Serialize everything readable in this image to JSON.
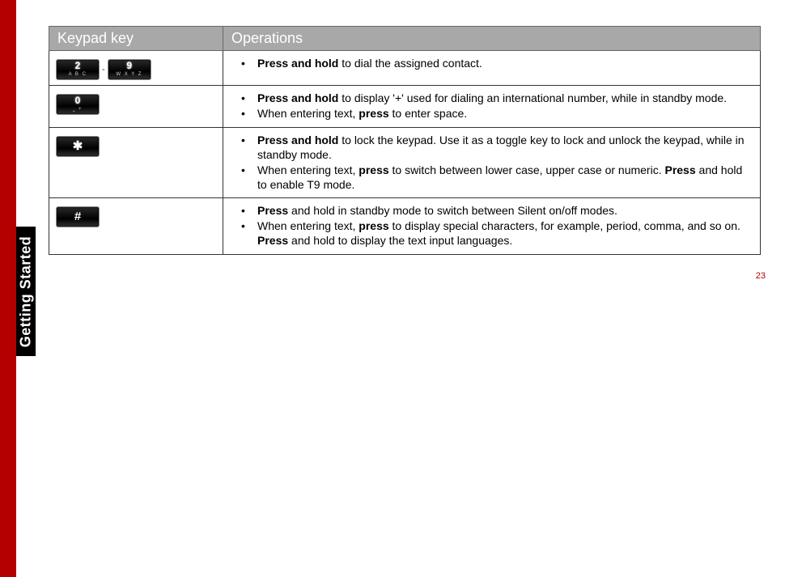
{
  "sidebar": {
    "label": "Getting Started"
  },
  "page_number": "23",
  "table": {
    "headers": [
      "Keypad key",
      "Operations"
    ],
    "rows": [
      {
        "key_type": "range_2_9",
        "key_a_num": "2",
        "key_a_sub": "A B C",
        "key_b_num": "9",
        "key_b_sub": "W X Y Z",
        "key_dash": "-",
        "ops": [
          {
            "segments": [
              {
                "t": "Press and hold",
                "b": true
              },
              {
                "t": " to dial the assigned contact.",
                "b": false
              }
            ]
          }
        ]
      },
      {
        "key_type": "zero",
        "key_num": "0",
        "key_sub": "⎵  +",
        "ops": [
          {
            "segments": [
              {
                "t": "Press and hold",
                "b": true
              },
              {
                "t": " to display '+' used for dialing an international number, while in standby mode.",
                "b": false
              }
            ]
          },
          {
            "segments": [
              {
                "t": "When entering text, ",
                "b": false
              },
              {
                "t": "press",
                "b": true
              },
              {
                "t": " to enter space.",
                "b": false
              }
            ]
          }
        ]
      },
      {
        "key_type": "star",
        "key_sym": "✱",
        "ops": [
          {
            "segments": [
              {
                "t": "Press and hold",
                "b": true
              },
              {
                "t": " to lock the keypad. Use it as a toggle key to lock and unlock the keypad, while in standby mode.",
                "b": false
              }
            ]
          },
          {
            "segments": [
              {
                "t": "When entering text, ",
                "b": false
              },
              {
                "t": "press",
                "b": true
              },
              {
                "t": " to switch between lower case, upper case or numeric. ",
                "b": false
              },
              {
                "t": "Press",
                "b": true
              },
              {
                "t": " and hold to enable T9 mode.",
                "b": false
              }
            ]
          }
        ]
      },
      {
        "key_type": "hash",
        "key_sym": "#",
        "ops": [
          {
            "segments": [
              {
                "t": "Press",
                "b": true
              },
              {
                "t": " and hold in standby mode to switch between Silent on/off modes.",
                "b": false
              }
            ]
          },
          {
            "segments": [
              {
                "t": "When entering text, ",
                "b": false
              },
              {
                "t": "press",
                "b": true
              },
              {
                "t": " to display special characters, for example, period, comma, and so on. ",
                "b": false
              },
              {
                "t": "Press",
                "b": true
              },
              {
                "t": " and hold to display the text input languages.",
                "b": false
              }
            ]
          }
        ]
      }
    ]
  }
}
